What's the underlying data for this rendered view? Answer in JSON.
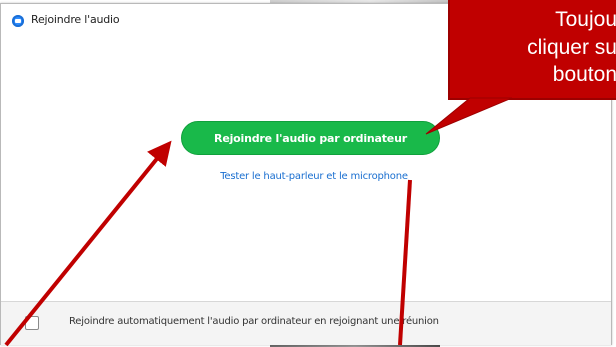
{
  "dialog": {
    "title": "Rejoindre l'audio",
    "join_button_label": "Rejoindre l'audio par ordinateur",
    "test_link_label": "Tester le haut-parleur et le microphone",
    "auto_join_label": "Rejoindre automatiquement l'audio par ordinateur en rejoignant une réunion",
    "auto_join_checked": false
  },
  "callout": {
    "lines": [
      "Toujou",
      "cliquer su",
      "bouton"
    ]
  },
  "colors": {
    "join_button": "#19b94a",
    "link": "#1a6fd0",
    "callout": "#c00000",
    "arrow": "#c00000"
  }
}
